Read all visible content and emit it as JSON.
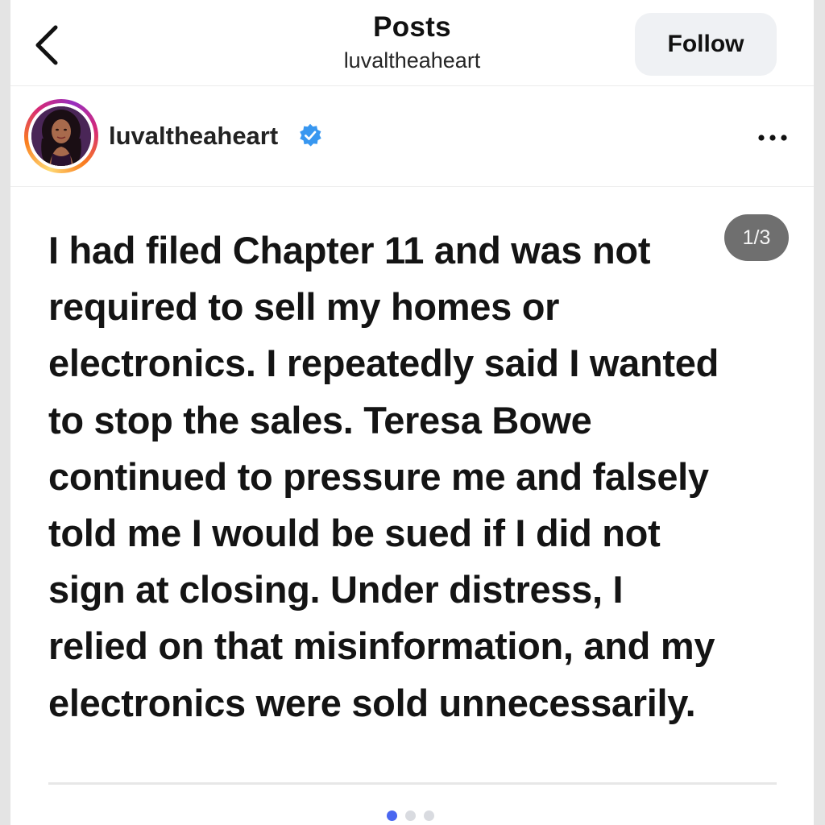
{
  "header": {
    "title": "Posts",
    "subtitle": "luvaltheaheart",
    "back_icon": "chevron-left-icon",
    "follow_label": "Follow"
  },
  "profile": {
    "username": "luvaltheaheart",
    "verified": true,
    "verified_icon": "verified-badge-icon",
    "more_icon": "more-horizontal-icon"
  },
  "post": {
    "counter": "1/3",
    "lines": {
      "l1": "I had filed Chapter 11 and was not",
      "l2": "required to sell my homes or",
      "l3": "electronics. I repeatedly said I wanted",
      "l4a": "to stop the sales. Teresa ",
      "l4b": "Bowe",
      "l5": "continued to pressure me and falsely",
      "l6": "told me I would be sued if I did not",
      "l7": "sign at closing. Under distress, I",
      "l8": "relied on that misinformation, and my",
      "l9": "electronics were sold unnecessarily."
    },
    "carousel": {
      "total": 3,
      "active": 1
    }
  },
  "colors": {
    "accent": "#4a67f0",
    "verified": "#3897f0",
    "follow_bg": "#eff1f4",
    "counter_bg": "#6f6f6f"
  }
}
